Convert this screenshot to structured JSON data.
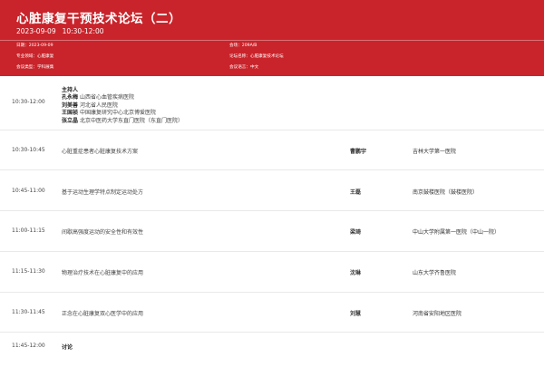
{
  "header": {
    "title": "心脏康复干预技术论坛（二）",
    "date": "2023-09-09",
    "time": "10:30-12:00",
    "meta": [
      {
        "label": "日期：",
        "value": "2023-09-09"
      },
      {
        "label": "会场：",
        "value": "209A/B"
      },
      {
        "label": "专业领域：",
        "value": "心脏康复"
      },
      {
        "label": "论坛名称：",
        "value": "心脏康复技术论坛"
      },
      {
        "label": "会议类型：",
        "value": "学科展集"
      },
      {
        "label": "会议语言：",
        "value": "中文"
      }
    ]
  },
  "schedule": {
    "hosts_row": {
      "time": "10:30-12:00",
      "heading": "主持人",
      "hosts": [
        {
          "name": "孔永梅",
          "org": "山西省心血管疾病医院"
        },
        {
          "name": "刘美善",
          "org": "河北省人民医院"
        },
        {
          "name": "王国祯",
          "org": "中国康复研究中心北京博爱医院"
        },
        {
          "name": "张立晶",
          "org": "北京中医药大学东直门医院（东直门医院）"
        }
      ]
    },
    "rows": [
      {
        "time": "10:30-10:45",
        "topic": "心脏重症患者心脏康复技术方案",
        "speaker": "曹鹏宇",
        "hospital": "吉林大学第一医院"
      },
      {
        "time": "10:45-11:00",
        "topic": "基于运动生理学特点制定运动处方",
        "speaker": "王磊",
        "hospital": "南京鼓楼医院（鼓楼医院）"
      },
      {
        "time": "11:00-11:15",
        "topic": "间歇高强度运动的安全性和有效性",
        "speaker": "梁琦",
        "hospital": "中山大学附属第一医院（中山一院）"
      },
      {
        "time": "11:15-11:30",
        "topic": "物理治疗技术在心脏康复中的应用",
        "speaker": "沈琳",
        "hospital": "山东大学齐鲁医院"
      },
      {
        "time": "11:30-11:45",
        "topic": "正念在心脏康复双心医学中的应用",
        "speaker": "刘慧",
        "hospital": "河南省安阳地区医院"
      },
      {
        "time": "11:45-12:00",
        "topic": "讨论",
        "speaker": "",
        "hospital": ""
      }
    ]
  },
  "colors": {
    "header_bg": "#c9242b",
    "header_text": "#ffffff",
    "row_border": "#e9e9e9"
  }
}
